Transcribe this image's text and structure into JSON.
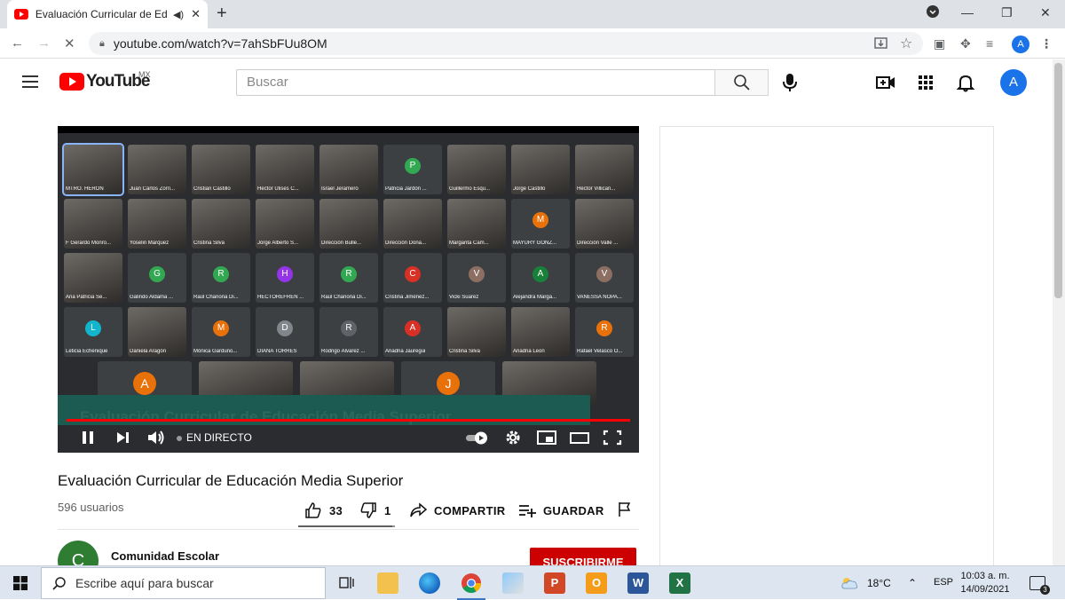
{
  "browser": {
    "tab_title": "Evaluación Curricular de Educ",
    "url": "youtube.com/watch?v=7ahSbFUu8OM",
    "profile_initial": "A"
  },
  "youtube": {
    "logo_text": "YouTube",
    "country": "MX",
    "search_placeholder": "Buscar",
    "account_initial": "A"
  },
  "video": {
    "title": "Evaluación Curricular de Educación Media Superior",
    "viewers": "596 usuarios",
    "likes": "33",
    "dislikes": "1",
    "like_ratio": 0.97,
    "share_label": "COMPARTIR",
    "save_label": "GUARDAR",
    "live_label": "EN DIRECTO",
    "overlay_title": "Evaluación Curricular de Educación Media Superior"
  },
  "channel": {
    "name": "Comunidad Escolar",
    "initial": "C",
    "subscribe_label": "SUSCRIBIRME"
  },
  "meeting_tiles": [
    {
      "name": "MTRO. HERÓN",
      "initial": "",
      "cam": true,
      "active": true
    },
    {
      "name": "Juan Carlos Zorri...",
      "initial": "",
      "cam": true
    },
    {
      "name": "Cristian Castillo",
      "initial": "",
      "cam": true
    },
    {
      "name": "Hector Ulises C...",
      "initial": "",
      "cam": true
    },
    {
      "name": "Israel Jeramero",
      "initial": "",
      "cam": true
    },
    {
      "name": "Patricia Jardón ...",
      "initial": "P",
      "color": "#33a852"
    },
    {
      "name": "Guillermo Esqu...",
      "initial": "",
      "cam": true
    },
    {
      "name": "Jorge Castillo",
      "initial": "",
      "cam": true
    },
    {
      "name": "Héctor Villicañ...",
      "initial": "",
      "cam": true
    },
    {
      "name": "F Gerardo Monro...",
      "initial": "",
      "cam": true
    },
    {
      "name": "Yoselin Marquez",
      "initial": "",
      "cam": true
    },
    {
      "name": "Cristina Silva",
      "initial": "",
      "cam": true
    },
    {
      "name": "Jorge Alberto S...",
      "initial": "",
      "cam": true
    },
    {
      "name": "Dirección Bulle...",
      "initial": "",
      "cam": true
    },
    {
      "name": "Dirección Dona...",
      "initial": "",
      "cam": true
    },
    {
      "name": "Margarita Cam...",
      "initial": "",
      "cam": true
    },
    {
      "name": "MAYURY GONZ...",
      "initial": "M",
      "color": "#e8710a"
    },
    {
      "name": "Dirección Valle ...",
      "initial": "",
      "cam": true
    },
    {
      "name": "Ana Patricia Se...",
      "initial": "",
      "cam": true
    },
    {
      "name": "Galindo Aldama ...",
      "initial": "G",
      "color": "#33a852"
    },
    {
      "name": "Raúl Chanona Di...",
      "initial": "R",
      "color": "#33a852"
    },
    {
      "name": "HECTOREFREN ...",
      "initial": "H",
      "color": "#9334e6"
    },
    {
      "name": "Raúl Chanona Di...",
      "initial": "R",
      "color": "#33a852"
    },
    {
      "name": "Cristina Jiménez...",
      "initial": "C",
      "color": "#d93025"
    },
    {
      "name": "Vicki Suarez",
      "initial": "V",
      "color": "#8d6e63"
    },
    {
      "name": "Alejandra Marga...",
      "initial": "A",
      "color": "#188038"
    },
    {
      "name": "VANESSA NOPA...",
      "initial": "V",
      "color": "#8d6e63"
    },
    {
      "name": "Leticia Echenique",
      "initial": "L",
      "color": "#12b5cb"
    },
    {
      "name": "Daniela Aragón",
      "initial": "",
      "cam": true
    },
    {
      "name": "Mónica Garduño...",
      "initial": "M",
      "color": "#e8710a"
    },
    {
      "name": "DIANA TORRES",
      "initial": "D",
      "color": "#80868b"
    },
    {
      "name": "Rodrigo Álvarez ...",
      "initial": "R",
      "color": "#5f6368"
    },
    {
      "name": "Ariadna Jauregui",
      "initial": "A",
      "color": "#d93025"
    },
    {
      "name": "Cristina Silva",
      "initial": "",
      "cam": true
    },
    {
      "name": "Ariadna Leon",
      "initial": "",
      "cam": true
    },
    {
      "name": "Rafael Velasco O...",
      "initial": "R",
      "color": "#e8710a"
    }
  ],
  "meeting_bottom_row": [
    {
      "initial": "A",
      "color": "#e8710a"
    },
    {
      "initial": "",
      "cam": true
    },
    {
      "initial": "",
      "cam": true
    },
    {
      "initial": "J",
      "color": "#e8710a"
    },
    {
      "initial": "",
      "cam": true
    }
  ],
  "taskbar": {
    "search_placeholder": "Escribe aquí para buscar",
    "temperature": "18°C",
    "language": "ESP",
    "time": "10:03 a. m.",
    "date": "14/09/2021",
    "notifications": "3"
  }
}
